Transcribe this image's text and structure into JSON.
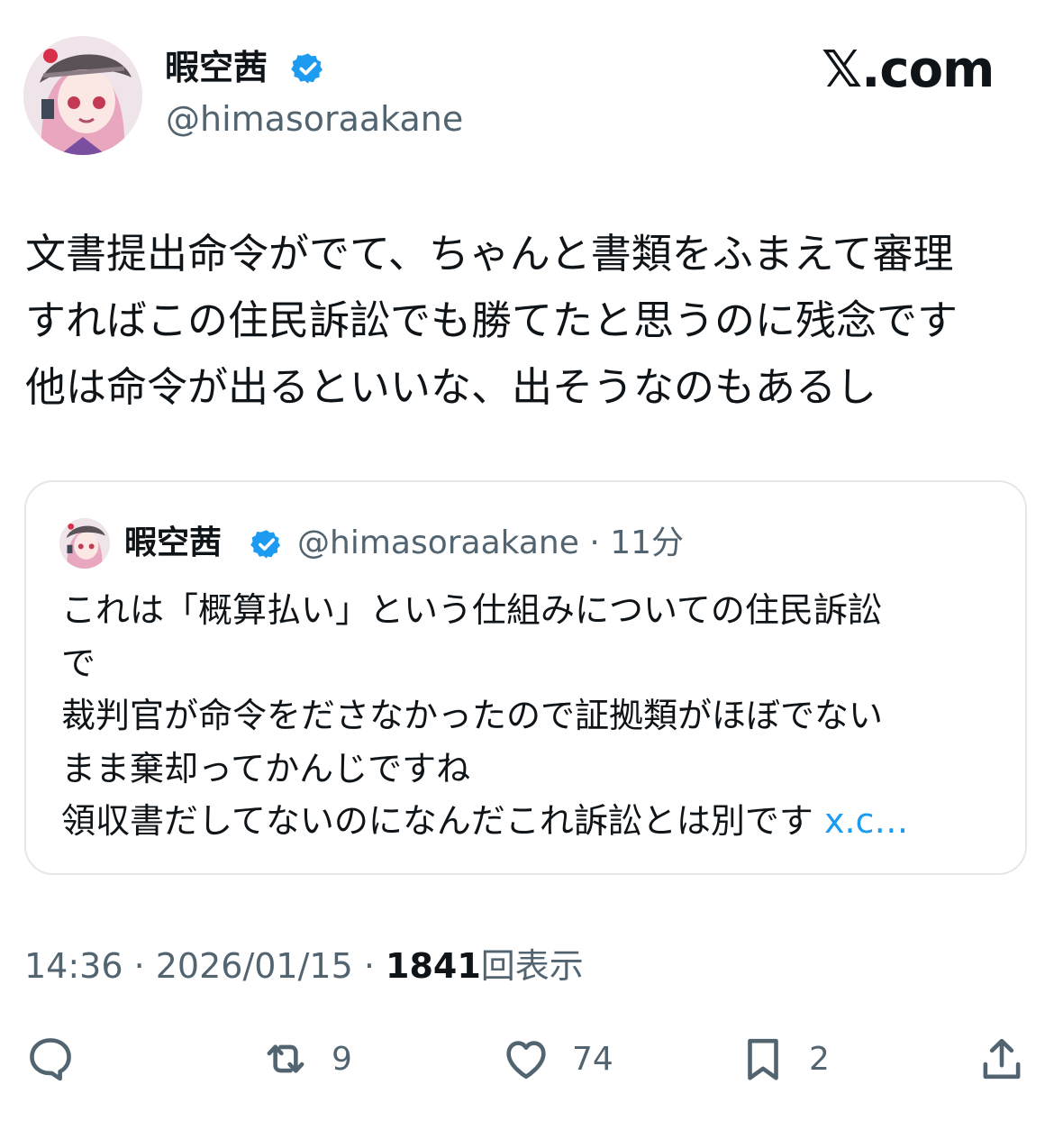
{
  "author": {
    "display_name": "暇空茜",
    "handle": "@himasoraakane",
    "verified": true
  },
  "brand": "𝕏.com",
  "tweet": {
    "lines": [
      "文書提出命令がでて、ちゃんと書類をふまえて審理",
      "すればこの住民訴訟でも勝てたと思うのに残念です",
      "他は命令が出るといいな、出そうなのもあるし"
    ]
  },
  "quote": {
    "display_name": "暇空茜",
    "handle_time": "@himasoraakane · 11分",
    "lines": [
      "これは「概算払い」という仕組みについての住民訴訟",
      "で",
      "裁判官が命令をださなかったので証拠類がほぼでない",
      "まま棄却ってかんじですね",
      "領収書だしてないのになんだこれ訴訟とは別です "
    ],
    "more_link": "x.c…"
  },
  "meta": {
    "time_date": "14:36 · 2026/01/15 · ",
    "views_count": "1841",
    "views_label": "回表示"
  },
  "actions": {
    "reply_count": "",
    "retweet_count": "9",
    "like_count": "74",
    "bookmark_count": "2"
  },
  "colors": {
    "text": "#0f1419",
    "secondary": "#536471",
    "link": "#1d9bf0",
    "verified": "#1d9bf0",
    "border": "#e3e7ea"
  },
  "icons": [
    "verified-badge-icon",
    "reply-icon",
    "retweet-icon",
    "like-icon",
    "bookmark-icon",
    "share-icon"
  ]
}
